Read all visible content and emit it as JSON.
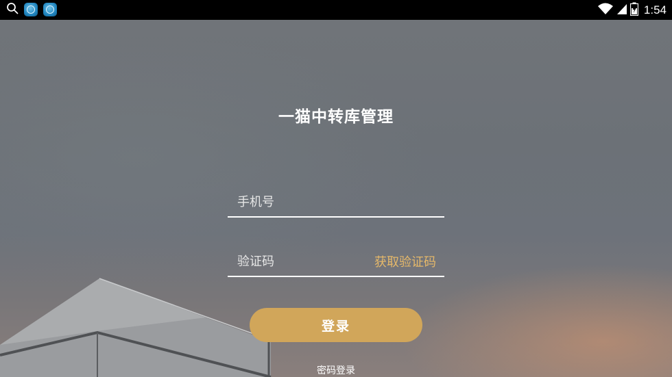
{
  "statusbar": {
    "time": "1:54",
    "icons": [
      "search-icon",
      "app-notification-icon",
      "app-notification-icon",
      "wifi-icon",
      "signal-icon",
      "battery-icon"
    ]
  },
  "app": {
    "title": "一猫中转库管理"
  },
  "form": {
    "phone_placeholder": "手机号",
    "code_placeholder": "验证码",
    "get_code_label": "获取验证码",
    "login_label": "登录",
    "password_login_label": "密码登录"
  },
  "colors": {
    "accent": "#d1a65a",
    "link": "#e5b86a",
    "statusbar": "#000000"
  }
}
